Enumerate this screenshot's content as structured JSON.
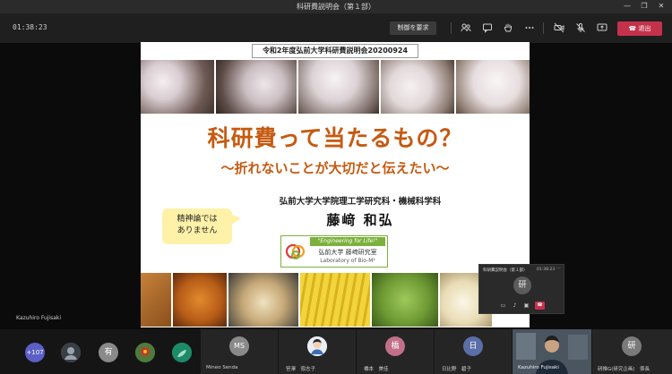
{
  "window": {
    "title": "科研費説明会（第１部）",
    "controls": [
      "—",
      "❐",
      "✕"
    ]
  },
  "toolbar": {
    "timer": "01:38:23",
    "request_control_label": "制御を要求",
    "leave_label": "退出",
    "icons": [
      "people-icon",
      "chat-icon",
      "raise-hand-icon",
      "more-icon",
      "camera-off-icon",
      "mic-off-icon",
      "share-icon"
    ]
  },
  "slide": {
    "header": "令和2年度弘前大学科研費説明会20200924",
    "title": "科研費って当たるもの？",
    "subtitle": "～折れないことが大切だと伝えたい～",
    "affiliation": "弘前大学大学院理工学研究科・機械科学科",
    "author": "藤﨑 和弘",
    "bubble_line1": "精神論では",
    "bubble_line2": "ありません",
    "lab_logo": {
      "tagline": "\"Engineering for Life!\"",
      "name_jp": "弘前大学 藤﨑研究室",
      "name_en": "Laboratory of Bio-M²"
    },
    "colors": {
      "title": "#c55a11",
      "bubble": "#fff2a8",
      "logo_green": "#7bb13c"
    }
  },
  "presenter": {
    "name": "Kazuhiro Fujisaki"
  },
  "mini_window": {
    "title": "科研費説明会（第１部）",
    "time": "01:38:23",
    "avatar_initial": "研"
  },
  "participants": {
    "overflow_count": "+107",
    "tiles": [
      {
        "initial": "有",
        "name": ""
      },
      {
        "initial": "MS",
        "name": "Mineo Senda"
      },
      {
        "initial": "",
        "name": "笹澤　寂志子"
      },
      {
        "initial": "橋",
        "name": "橋本　美佳"
      },
      {
        "initial": "日",
        "name": "日比野　碧子"
      },
      {
        "initial": "",
        "name": "Kazuhiro Fujisaki"
      },
      {
        "initial": "研",
        "name": "研推G(研究企画)　係長"
      }
    ]
  }
}
